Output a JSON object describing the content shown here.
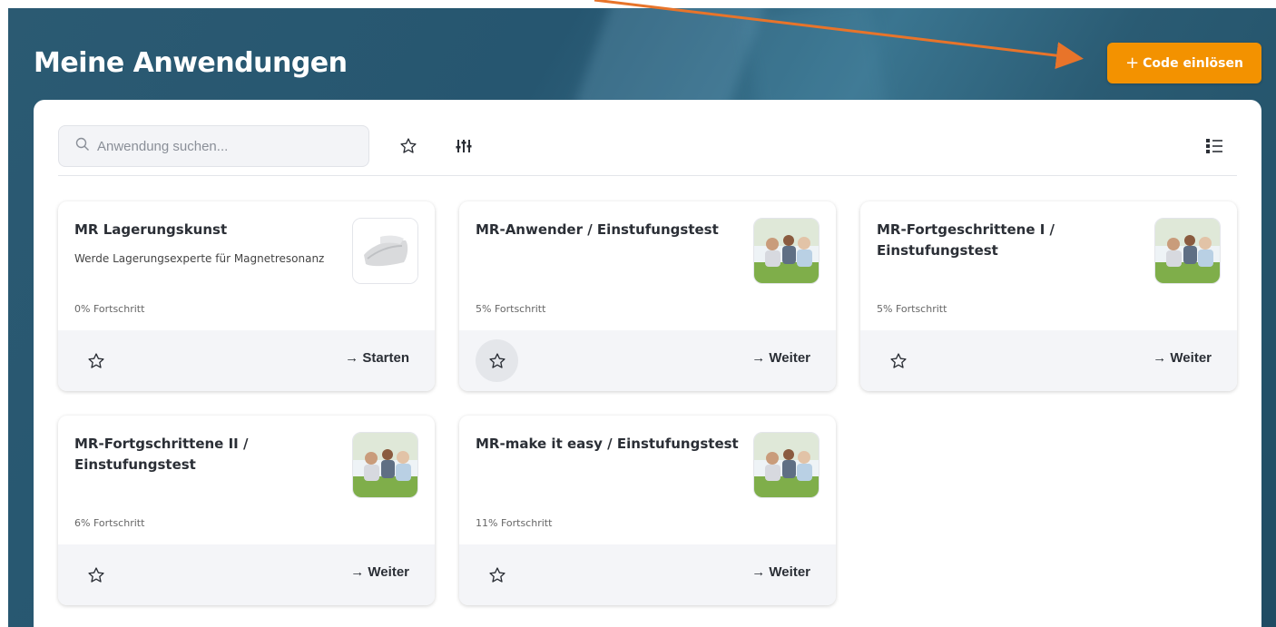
{
  "header": {
    "title": "Meine Anwendungen",
    "redeem_button": {
      "plus": "+",
      "label": "Code einlösen"
    }
  },
  "toolbar": {
    "search_placeholder": "Anwendung suchen...",
    "icons": [
      "search-icon",
      "star-outline-icon",
      "filter-sliders-icon",
      "list-view-icon"
    ]
  },
  "colors": {
    "accent": "#f39200",
    "background": "#2b5a72",
    "arrow": "#e8742a"
  },
  "cards": [
    {
      "title": "MR Lagerungskunst",
      "description": "Werde Lagerungsexperte für Magnetresonanz",
      "progress": "0% Fortschritt",
      "action": "Starten",
      "thumbnail": "pillow-image",
      "favorite_hover": false
    },
    {
      "title": "MR-Anwender / Einstufungstest",
      "description": "",
      "progress": "5% Fortschritt",
      "action": "Weiter",
      "thumbnail": "people-photo",
      "favorite_hover": true
    },
    {
      "title": "MR-Fortgeschrittene I / Einstufungstest",
      "description": "",
      "progress": "5% Fortschritt",
      "action": "Weiter",
      "thumbnail": "people-photo",
      "favorite_hover": false
    },
    {
      "title": "MR-Fortgschrittene II / Einstufungstest",
      "description": "",
      "progress": "6% Fortschritt",
      "action": "Weiter",
      "thumbnail": "people-photo",
      "favorite_hover": false
    },
    {
      "title": "MR-make it easy / Einstufungstest",
      "description": "",
      "progress": "11% Fortschritt",
      "action": "Weiter",
      "thumbnail": "people-photo",
      "favorite_hover": false
    }
  ]
}
